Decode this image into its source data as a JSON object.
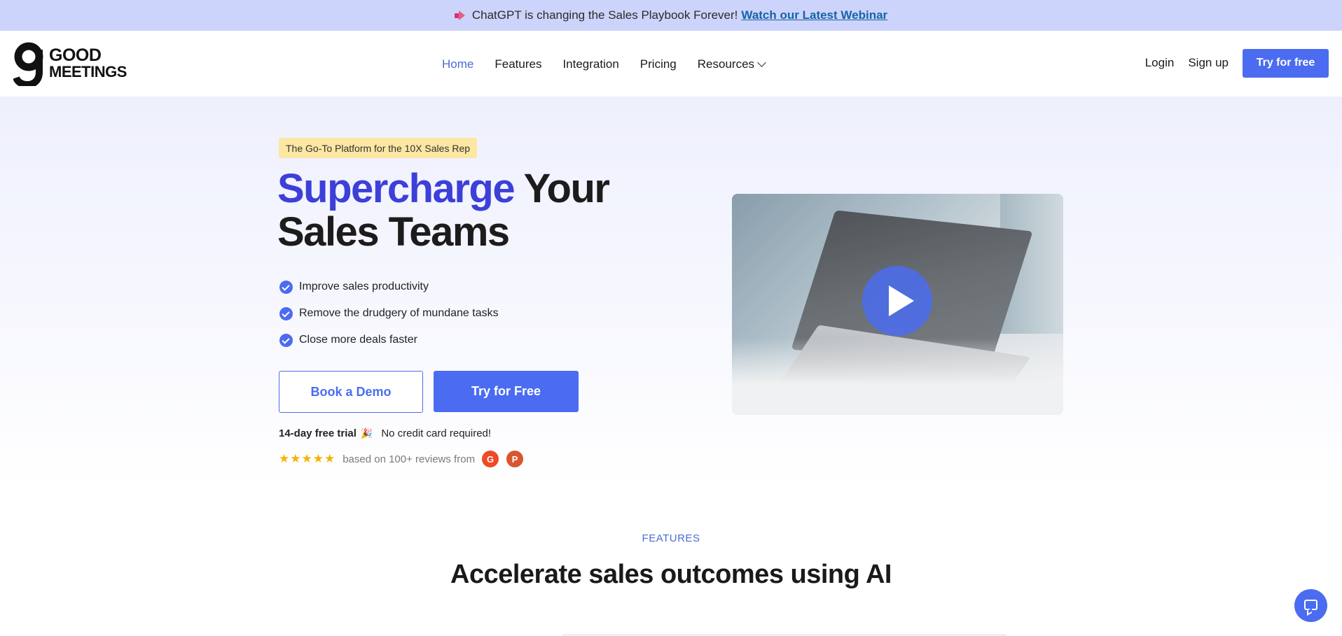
{
  "announcement": {
    "icon": "megaphone-icon",
    "text": "ChatGPT is changing the Sales Playbook Forever!",
    "link_label": "Watch our Latest Webinar"
  },
  "header": {
    "logo": {
      "line1": "GOOD",
      "line2": "MEETINGS"
    },
    "nav": [
      {
        "label": "Home",
        "active": true
      },
      {
        "label": "Features"
      },
      {
        "label": "Integration"
      },
      {
        "label": "Pricing"
      },
      {
        "label": "Resources",
        "dropdown": true
      }
    ],
    "login_label": "Login",
    "signup_label": "Sign up",
    "try_label": "Try for free"
  },
  "hero": {
    "tagline": "The Go-To Platform for the 10X Sales Rep",
    "title_accent": "Supercharge",
    "title_rest_1": "Your",
    "title_rest_2": "Sales Teams",
    "bullets": [
      "Improve sales productivity",
      "Remove the drudgery of mundane tasks",
      "Close more deals faster"
    ],
    "demo_label": "Book a Demo",
    "free_label": "Try for Free",
    "trial_bold": "14-day free trial",
    "trial_emoji": "🎉",
    "trial_rest": "No credit card required!",
    "stars": "★★★★★",
    "rating": 5,
    "reviews_text": "based on 100+ reviews from",
    "badge_g2": "G",
    "badge_ph": "P"
  },
  "features": {
    "label": "FEATURES",
    "title": "Accelerate sales outcomes using AI"
  },
  "colors": {
    "brand": "#4b6cf0",
    "accent_title": "#3d3fd9",
    "announce_bg": "#cdd4fb",
    "tagline_bg": "#fce7a3"
  }
}
